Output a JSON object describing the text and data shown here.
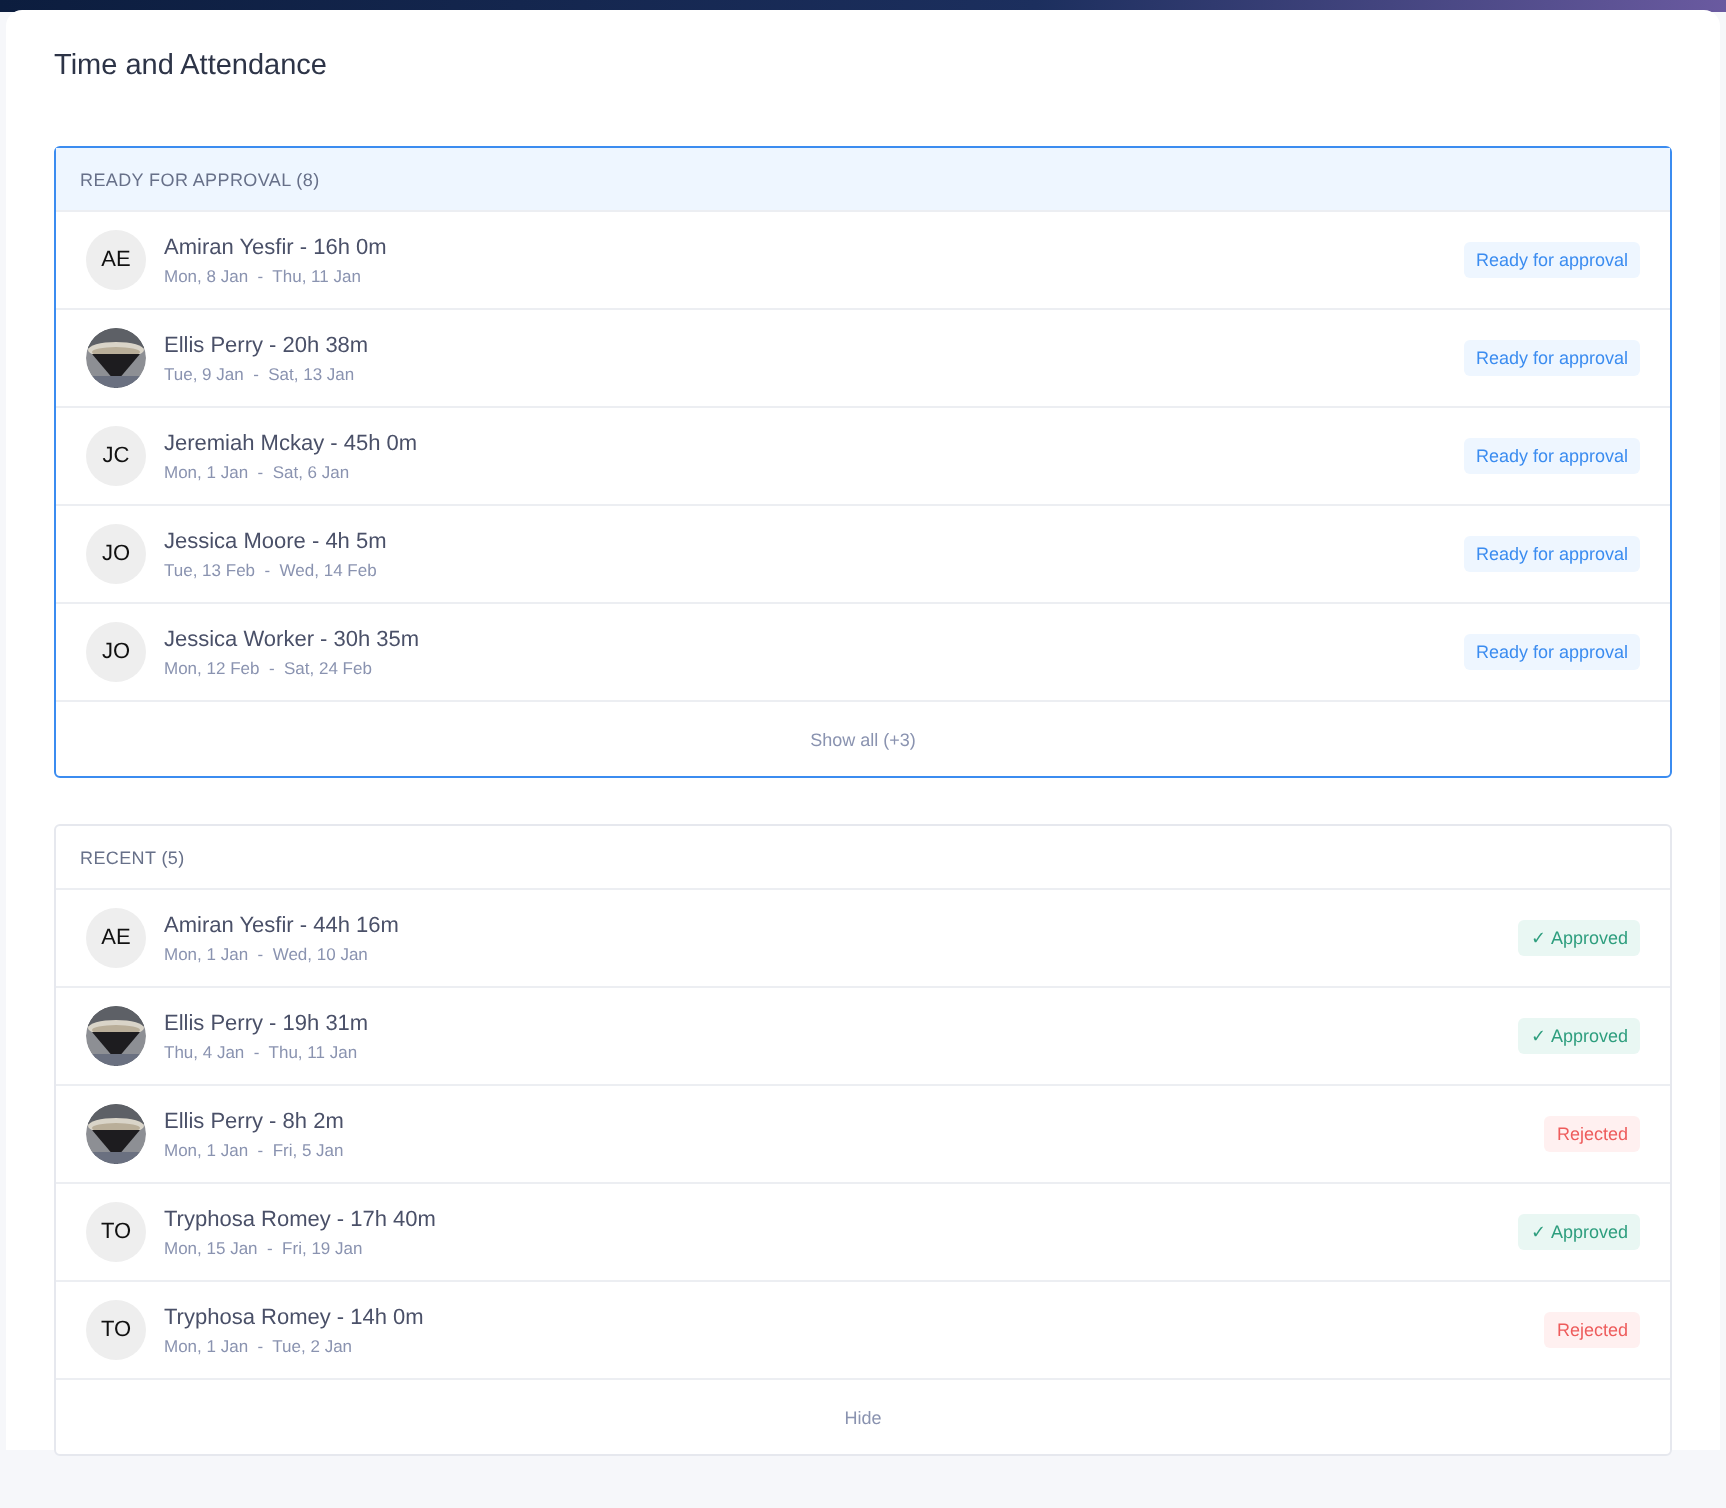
{
  "page": {
    "title": "Time and Attendance"
  },
  "sections": [
    {
      "title": "READY FOR APPROVAL (8)",
      "highlighted": true,
      "footer": "Show all (+3)",
      "rows": [
        {
          "avatar": {
            "kind": "initials",
            "text": "AE"
          },
          "name": "Amiran Yesfir - 16h 0m",
          "dates": "Mon, 8 Jan  -  Thu, 11 Jan",
          "status": {
            "kind": "ready",
            "label": "Ready for approval"
          }
        },
        {
          "name": "Ellis Perry - 20h 38m",
          "dates": "Tue, 9 Jan  -  Sat, 13 Jan",
          "status": {
            "kind": "ready",
            "label": "Ready for approval"
          }
        },
        {
          "avatar": {
            "kind": "initials",
            "text": "JC"
          },
          "name": "Jeremiah Mckay - 45h 0m",
          "dates": "Mon, 1 Jan  -  Sat, 6 Jan",
          "status": {
            "kind": "ready",
            "label": "Ready for approval"
          }
        },
        {
          "avatar": {
            "kind": "initials",
            "text": "JO"
          },
          "name": "Jessica Moore - 4h 5m",
          "dates": "Tue, 13 Feb  -  Wed, 14 Feb",
          "status": {
            "kind": "ready",
            "label": "Ready for approval"
          }
        },
        {
          "avatar": {
            "kind": "initials",
            "text": "JO"
          },
          "name": "Jessica Worker - 30h 35m",
          "dates": "Mon, 12 Feb  -  Sat, 24 Feb",
          "status": {
            "kind": "ready",
            "label": "Ready for approval"
          }
        }
      ]
    },
    {
      "title": "RECENT (5)",
      "highlighted": false,
      "footer": "Hide",
      "rows": [
        {
          "avatar": {
            "kind": "initials",
            "text": "AE"
          },
          "name": "Amiran Yesfir - 44h 16m",
          "dates": "Mon, 1 Jan  -  Wed, 10 Jan",
          "status": {
            "kind": "approved",
            "label": "✓ Approved"
          }
        },
        {
          "name": "Ellis Perry - 19h 31m",
          "dates": "Thu, 4 Jan  -  Thu, 11 Jan",
          "status": {
            "kind": "approved",
            "label": "✓ Approved"
          }
        },
        {
          "name": "Ellis Perry - 8h 2m",
          "dates": "Mon, 1 Jan  -  Fri, 5 Jan",
          "status": {
            "kind": "rejected",
            "label": "Rejected"
          }
        },
        {
          "avatar": {
            "kind": "initials",
            "text": "TO"
          },
          "name": "Tryphosa Romey - 17h 40m",
          "dates": "Mon, 15 Jan  -  Fri, 19 Jan",
          "status": {
            "kind": "approved",
            "label": "✓ Approved"
          }
        },
        {
          "avatar": {
            "kind": "initials",
            "text": "TO"
          },
          "name": "Tryphosa Romey - 14h 0m",
          "dates": "Mon, 1 Jan  -  Tue, 2 Jan",
          "status": {
            "kind": "rejected",
            "label": "Rejected"
          }
        }
      ]
    }
  ]
}
